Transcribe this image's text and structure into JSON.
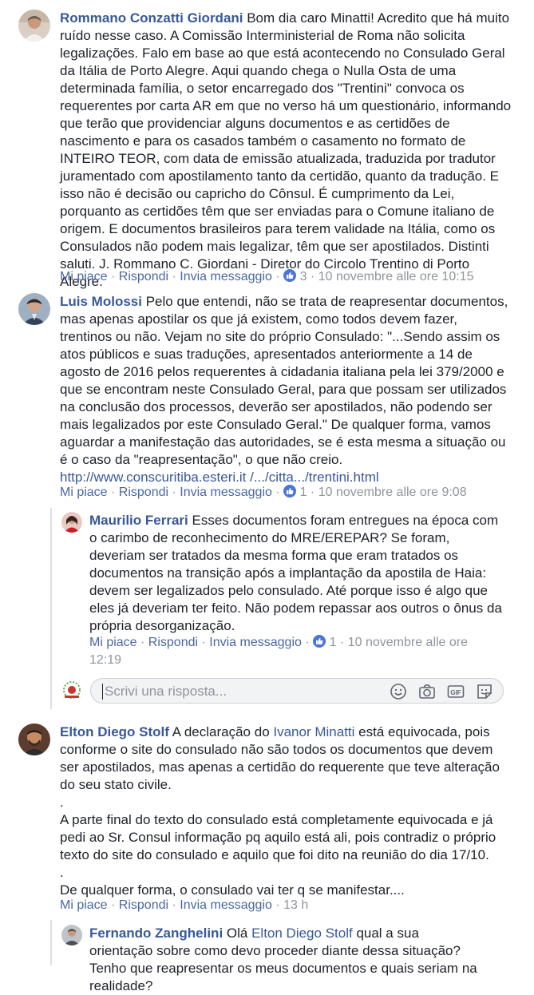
{
  "comments": [
    {
      "author": "Rommano Conzatti Giordani",
      "text": " Bom dia caro Minatti! Acredito que há muito ruído nesse caso. A Comissão Interministerial de Roma não solicita legalizações. Falo em base ao que está acontecendo no Consulado Geral da Itália de Porto Alegre. Aqui quando chega o Nulla Osta de uma determinada família, o setor encarregado dos \"Trentini\" convoca os requerentes por carta AR em que no verso há um questionário, informando que terão que providenciar alguns documentos e as certidões de nascimento e para os casados também o casamento no formato de INTEIRO TEOR, com data de emissão atualizada, traduzida por tradutor juramentado com apostilamento tanto da certidão, quanto da tradução. E isso não é decisão ou capricho do Cônsul. É cumprimento da Lei, porquanto as certidões têm que ser enviadas para o Comune italiano de origem. E documentos brasileiros para terem validade na Itália, como os Consulados não podem mais legalizar, têm que ser apostilados. Distinti saluti. J. Rommano C. Giordani - Diretor do Circolo Trentino di Porto Alegre.",
      "like": "Mi piace",
      "reply": "Rispondi",
      "message": "Invia messaggio",
      "likes": "3",
      "time": "10 novembre alle ore 10:15"
    },
    {
      "author": "Luis Molossi",
      "text": " Pelo que entendi, não se trata de reapresentar documentos, mas apenas apostilar os que já existem, como todos devem fazer, trentinos ou não. Vejam no site do próprio Consulado: \"...Sendo assim os atos públicos e suas traduções, apresentados anteriormente a 14 de agosto de 2016 pelos requerentes à cidadania italiana pela lei 379/2000 e que se encontram neste Consulado Geral, para que possam ser utilizados na conclusão dos processos, deverão ser apostilados, não podendo ser mais legalizados por este Consulado Geral.\" De qualquer forma, vamos aguardar a manifestação das autoridades, se é esta mesma a situação ou é o caso da \"reapresentação\", o que não creio. ",
      "link": "http://www.conscuritiba.esteri.it /.../citta.../trentini.html",
      "like": "Mi piace",
      "reply": "Rispondi",
      "message": "Invia messaggio",
      "likes": "1",
      "time": "10 novembre alle ore 9:08"
    },
    {
      "author": "Maurilio Ferrari",
      "text": " Esses documentos foram entregues na época com o carimbo de reconhecimento do MRE/EREPAR? Se foram, deveriam ser tratados da mesma forma que eram tratados os documentos na transição após a implantação da apostila de Haia: devem ser legalizados pelo consulado. Até porque isso é algo que eles já deveriam ter feito. Não podem repassar aos outros o ônus da própria desorganização.",
      "like": "Mi piace",
      "reply": "Rispondi",
      "message": "Invia messaggio",
      "likes": "1",
      "time": "10 novembre alle ore 12:19"
    },
    {
      "author": "Elton Diego Stolf",
      "text_before": " A declaração do ",
      "mention": "Ivanor Minatti",
      "text_after": " está equivocada, pois conforme o site do consulado não são todos os documentos que devem ser apostilados, mas apenas a certidão do requerente que teve alteração do seu stato civile.",
      "dot1": ".",
      "para2": "A parte final do texto do consulado está completamente equivocada e já pedi ao Sr. Consul informação pq aquilo está ali, pois contradiz o próprio texto do site do consulado e aquilo que foi dito na reunião do dia 17/10.",
      "dot2": ".",
      "para3": "De qualquer forma, o consulado vai ter q se manifestar....",
      "like": "Mi piace",
      "reply": "Rispondi",
      "message": "Invia messaggio",
      "time": "13 h"
    },
    {
      "author": "Fernando Zanghelini",
      "text_before": " Olá ",
      "mention": "Elton Diego Stolf",
      "text_after": " qual a sua orientação sobre como devo proceder diante dessa situação? Tenho que reapresentar os meus documentos e quais seriam na realidade?"
    }
  ],
  "reply_box": {
    "placeholder": "Scrivi una risposta..."
  },
  "separators": {
    "dot": " · "
  },
  "colors": {
    "link": "#385898",
    "meta": "#90949c",
    "like_badge": "#4a76d8"
  },
  "icons": [
    "smiley-icon",
    "camera-icon",
    "gif-icon",
    "sticker-icon",
    "thumbs-up-icon"
  ]
}
